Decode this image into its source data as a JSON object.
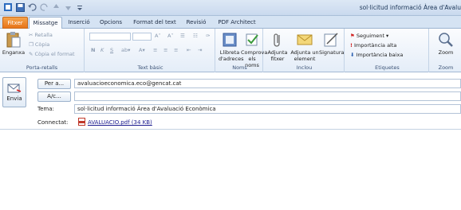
{
  "window": {
    "title": "sol·licitud informació Àrea d'Avalu"
  },
  "quick_access": {
    "icons": [
      "outlook-icon",
      "save-icon",
      "undo-icon",
      "redo-icon",
      "up-arrow-icon",
      "down-arrow-icon",
      "customize-icon"
    ]
  },
  "tabs": [
    {
      "label": "Fitxer",
      "active": false,
      "file": true
    },
    {
      "label": "Missatge",
      "active": true,
      "file": false
    },
    {
      "label": "Inserció",
      "active": false,
      "file": false
    },
    {
      "label": "Opcions",
      "active": false,
      "file": false
    },
    {
      "label": "Format del text",
      "active": false,
      "file": false
    },
    {
      "label": "Revisió",
      "active": false,
      "file": false
    },
    {
      "label": "PDF Architect",
      "active": false,
      "file": false
    }
  ],
  "ribbon": {
    "clipboard": {
      "label": "Porta-retalls",
      "paste": "Enganxa",
      "cut": "Retalla",
      "copy": "Còpia",
      "format_painter": "Còpia el format"
    },
    "basic_text": {
      "label": "Text bàsic",
      "bold": "N",
      "italic": "K",
      "underline": "S"
    },
    "names": {
      "label": "Noms",
      "address_book": "Llibreta d'adreces",
      "check_names": "Comprova els noms"
    },
    "include": {
      "label": "Inclou",
      "attach_file": "Adjunta fitxer",
      "attach_item": "Adjunta un element",
      "signature": "Signatura"
    },
    "tags": {
      "label": "Etiquetes",
      "follow_up": "Seguiment",
      "high": "Importància alta",
      "low": "Importància baixa"
    },
    "zoom": {
      "label": "Zoom",
      "zoom": "Zoom"
    }
  },
  "compose": {
    "send": "Envia",
    "to_button": "Per a...",
    "cc_button": "A/c...",
    "subject_label": "Tema:",
    "attached_label": "Connectat:",
    "to_value": "avaluacioeconomica.eco@gencat.cat",
    "cc_value": "",
    "subject_value": "sol·licitud informació Àrea d'Avaluació Econòmica",
    "attachment": "AVALUACIO.pdf (34 KB)"
  }
}
